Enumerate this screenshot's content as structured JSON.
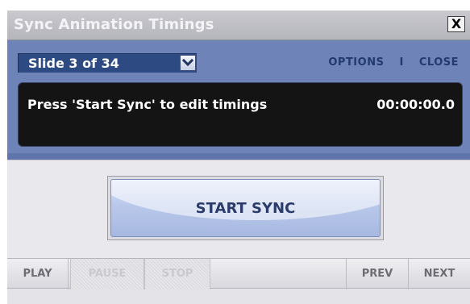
{
  "window": {
    "title": "Sync Animation Timings",
    "close_glyph": "X"
  },
  "panel": {
    "slide_selector": {
      "label": "Slide 3 of 34"
    },
    "links": {
      "options": "OPTIONS",
      "separator": "I",
      "close": "CLOSE"
    },
    "display": {
      "message": "Press 'Start Sync' to edit timings",
      "timer": "00:00:00.0"
    }
  },
  "main": {
    "start_sync_label": "START SYNC"
  },
  "toolbar": {
    "play": "PLAY",
    "pause": "PAUSE",
    "stop": "STOP",
    "prev": "PREV",
    "next": "NEXT"
  },
  "icons": {
    "dropdown": "chevron-down-icon",
    "close": "close-icon"
  },
  "colors": {
    "panel_blue": "#6e84b8",
    "display_black": "#141414",
    "button_text": "#2b3c6b"
  }
}
